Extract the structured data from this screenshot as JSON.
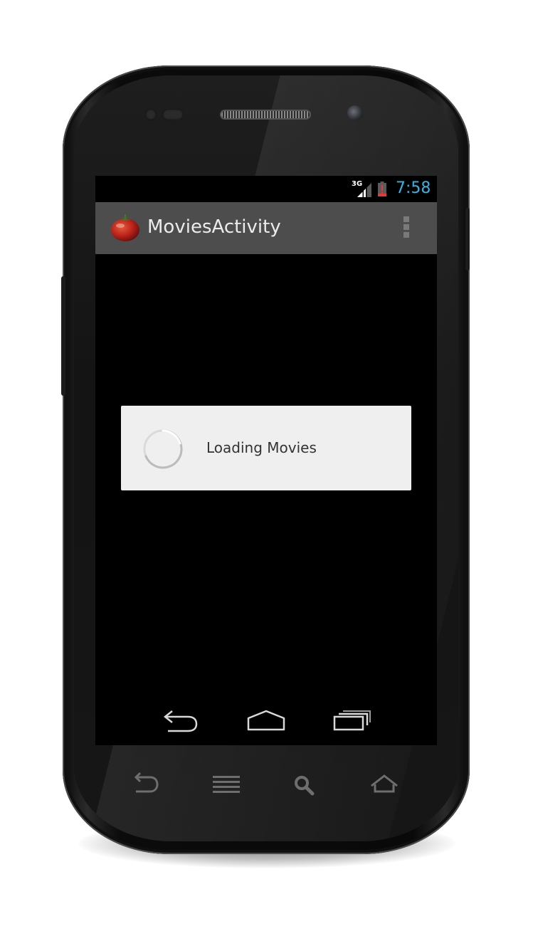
{
  "device": {
    "model": "android-phone-frame"
  },
  "status_bar": {
    "network_type": "3G",
    "clock": "7:58",
    "clock_color": "#33b5e5",
    "battery_alert_color": "#e53935",
    "icons": [
      "signal-icon",
      "battery-icon"
    ]
  },
  "action_bar": {
    "title": "MoviesActivity",
    "app_icon": "tomato-icon",
    "menu_icon": "overflow-menu-icon"
  },
  "dialog": {
    "message": "Loading Movies",
    "spinner": "progress-spinner-icon"
  },
  "nav_bar": {
    "buttons": [
      "back-icon",
      "home-icon",
      "recent-apps-icon"
    ]
  },
  "hardware_keys": [
    "back-key-icon",
    "menu-key-icon",
    "search-key-icon",
    "home-key-icon"
  ]
}
